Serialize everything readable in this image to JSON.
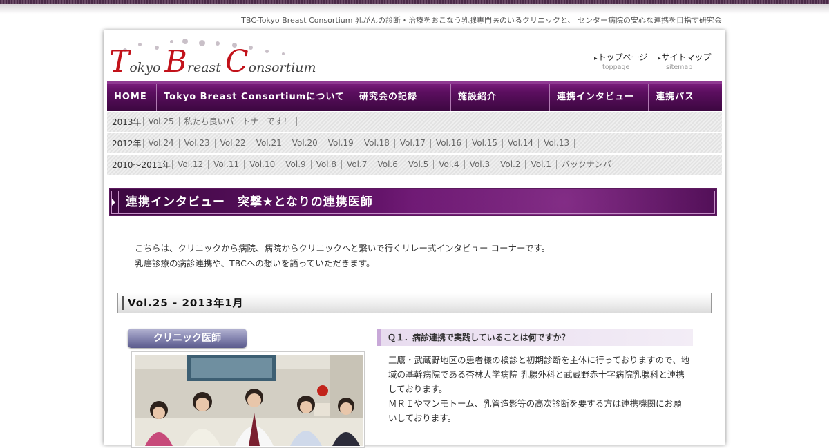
{
  "site": {
    "tagline": "TBC-Tokyo Breast Consortium 乳がんの診断・治療をおこなう乳腺専門医のいるクリニックと、 センター病院の安心な連携を目指す研究会",
    "logo": {
      "letters": [
        "T",
        "okyo ",
        "B",
        "reast ",
        "C",
        "onsortium"
      ]
    }
  },
  "toplinks": [
    {
      "label": "トップページ",
      "sub": "toppage"
    },
    {
      "label": "サイトマップ",
      "sub": "sitemap"
    }
  ],
  "nav": [
    {
      "label": "HOME"
    },
    {
      "label": "Tokyo Breast Consortiumについて"
    },
    {
      "label": "研究会の記録"
    },
    {
      "label": "施設紹介"
    },
    {
      "label": "連携インタビュー"
    },
    {
      "label": "連携パス"
    }
  ],
  "archive": [
    {
      "year": "2013年",
      "links": [
        "Vol.25",
        "私たち良いパートナーです！"
      ]
    },
    {
      "year": "2012年",
      "links": [
        "Vol.24",
        "Vol.23",
        "Vol.22",
        "Vol.21",
        "Vol.20",
        "Vol.19",
        "Vol.18",
        "Vol.17",
        "Vol.16",
        "Vol.15",
        "Vol.14",
        "Vol.13"
      ]
    },
    {
      "year": "2010～2011年",
      "links": [
        "Vol.12",
        "Vol.11",
        "Vol.10",
        "Vol.9",
        "Vol.8",
        "Vol.7",
        "Vol.6",
        "Vol.5",
        "Vol.4",
        "Vol.3",
        "Vol.2",
        "Vol.1",
        "バックナンバー"
      ]
    }
  ],
  "section_title": "連携インタビュー　突撃★となりの連携医師",
  "intro": [
    "こちらは、クリニックから病院、病院からクリニックへと繋いで行くリレー式インタビュー コーナーです。",
    "乳癌診療の病診連携や、TBCへの想いを語っていただきます。"
  ],
  "volume": "Vol.25  -  2013年1月",
  "clinic_badge": "クリニック医師",
  "question": "Ｑ１．病診連携で実践していることは何ですか？",
  "answer": [
    "三鷹・武蔵野地区の患者様の検診と初期診断を主体に行っておりますので、地域の基幹病院である杏林大学病院 乳腺外科と武蔵野赤十字病院乳腺科と連携しております。",
    "ＭＲＩやマンモトーム、乳管造影等の高次診断を要する方は連携機関にお願いしております。"
  ],
  "colors": {
    "nav_purple": "#5c0f60",
    "logo_red": "#c2121a",
    "badge_blue": "#7a7aaa"
  }
}
